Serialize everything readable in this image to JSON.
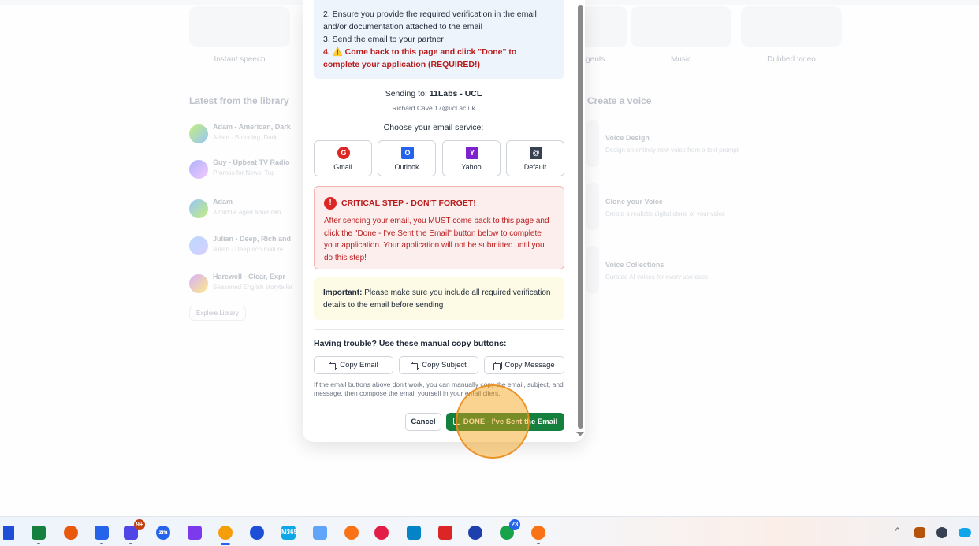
{
  "background": {
    "tiles": [
      "Instant speech",
      "Agents",
      "Music",
      "Dubbed video"
    ],
    "library_title": "Latest from the library",
    "library_items": [
      {
        "name": "Adam - American, Dark",
        "sub": "Adam - Brooding, Dark"
      },
      {
        "name": "Guy - Upbeat TV Radio",
        "sub": "Promos for News, Top"
      },
      {
        "name": "Adam",
        "sub": "A middle aged American"
      },
      {
        "name": "Julian - Deep, Rich and",
        "sub": "Julian - Deep rich mature"
      },
      {
        "name": "Harewell - Clear, Expr",
        "sub": "Seasoned English storyteller"
      }
    ],
    "explore_label": "Explore Library",
    "voice_title": "Create a voice",
    "voice_items": [
      {
        "title": "Voice Design",
        "sub": "Design an entirely new voice from a text prompt"
      },
      {
        "title": "Clone your Voice",
        "sub": "Create a realistic digital clone of your voice"
      },
      {
        "title": "Voice Collections",
        "sub": "Curated AI voices for every use case"
      }
    ]
  },
  "modal": {
    "instructions": {
      "step2": "2. Ensure you provide the required verification in the email and/or documentation attached to the email",
      "step3": "3. Send the email to your partner",
      "step4": "4. ⚠️ Come back to this page and click \"Done\" to complete your application (REQUIRED!)"
    },
    "sending_prefix": "Sending to: ",
    "sending_to": "11Labs - UCL",
    "sending_email": "Richard.Cave.17@ucl.ac.uk",
    "choose_label": "Choose your email service:",
    "services": [
      {
        "label": "Gmail",
        "icon": "G",
        "color": "#dc2626"
      },
      {
        "label": "Outlook",
        "icon": "O",
        "color": "#2563eb"
      },
      {
        "label": "Yahoo",
        "icon": "Y",
        "color": "#7e22ce"
      },
      {
        "label": "Default",
        "icon": "@",
        "color": "#374151"
      }
    ],
    "critical": {
      "icon": "!",
      "title": "CRITICAL STEP - DON'T FORGET!",
      "body": "After sending your email, you MUST come back to this page and click the \"Done - I've Sent the Email\" button below to complete your application. Your application will not be submitted until you do this step!"
    },
    "important": {
      "label": "Important:",
      "text": " Please make sure you include all required verification details to the email before sending"
    },
    "trouble_label": "Having trouble? Use these manual copy buttons:",
    "copy_buttons": [
      "Copy Email",
      "Copy Subject",
      "Copy Message"
    ],
    "manual_note": "If the email buttons above don't work, you can manually copy the email, subject, and message, then compose the email yourself in your email client.",
    "cancel_label": "Cancel",
    "done_label": "DONE - I've Sent the Email"
  },
  "taskbar": {
    "badges": {
      "teams": "9+",
      "whatsapp": "23"
    },
    "icons": [
      "start-icon",
      "excel-icon",
      "powerpoint-icon",
      "outlook-icon",
      "teams-icon",
      "zoom-icon",
      "stream-icon",
      "chrome-icon",
      "audio-icon",
      "m365-icon",
      "network-icon",
      "app-icon",
      "slack-icon",
      "remote-desktop-icon",
      "calendar-icon",
      "nordvpn-icon",
      "whatsapp-icon",
      "claude-icon"
    ],
    "zoom_label": "zm",
    "m365_label": "M365"
  }
}
